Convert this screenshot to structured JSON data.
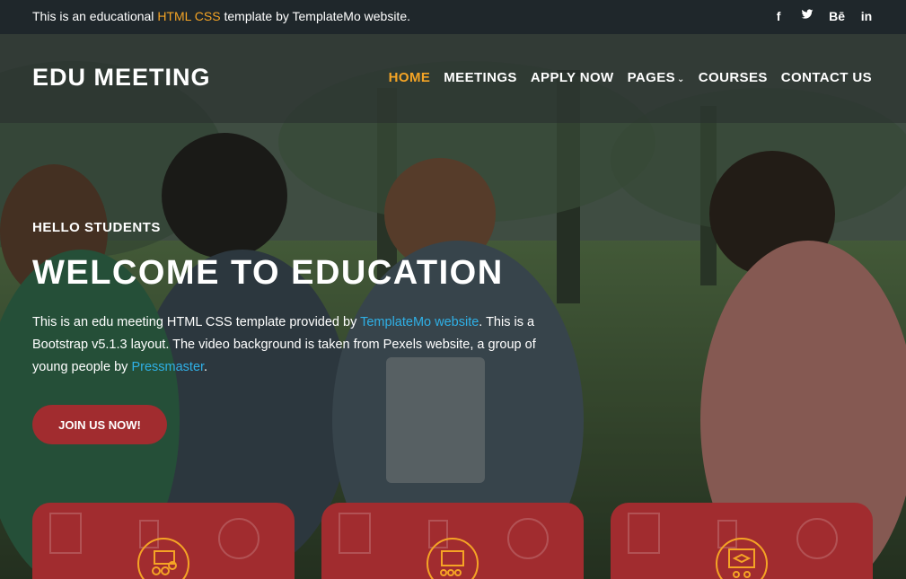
{
  "topbar": {
    "msg_pre": "This is an educational",
    "msg_highlight": "HTML CSS",
    "msg_post": "template by TemplateMo website.",
    "social": [
      "f",
      "𝕋",
      "Bē",
      "in"
    ]
  },
  "header": {
    "logo": "EDU MEETING",
    "nav": {
      "home": "HOME",
      "meetings": "MEETINGS",
      "apply": "APPLY NOW",
      "pages": "PAGES",
      "courses": "COURSES",
      "contact": "CONTACT US"
    }
  },
  "hero": {
    "kicker": "HELLO STUDENTS",
    "headline": "WELCOME TO EDUCATION",
    "desc_1": "This is an edu meeting HTML CSS template provided by",
    "desc_link_1": "TemplateMo website",
    "desc_2": ". This is a Bootstrap v5.1.3 layout. The video background is taken from Pexels website, a group of young people by",
    "desc_link_2": "Pressmaster",
    "desc_3": ".",
    "cta": "JOIN US NOW!"
  },
  "colors": {
    "accent": "#f5a425",
    "brand_red": "#a12c2f",
    "link": "#2fb0e6"
  },
  "cards": [
    {
      "icon": "group-meeting-icon"
    },
    {
      "icon": "classroom-presentation-icon"
    },
    {
      "icon": "graduation-board-icon"
    }
  ]
}
